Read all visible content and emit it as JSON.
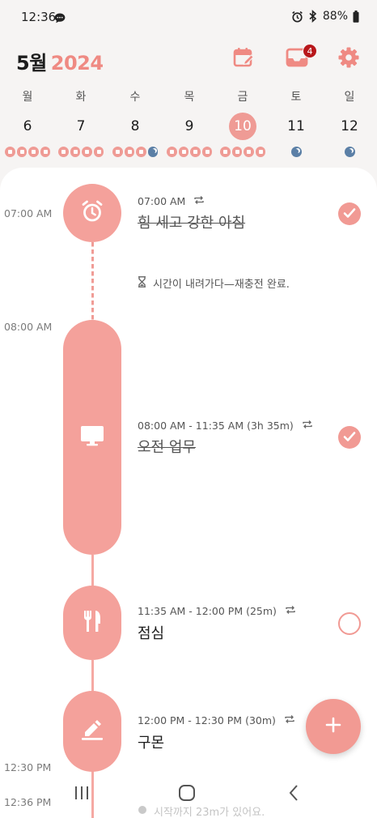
{
  "status_bar": {
    "time": "12:36",
    "battery": "88%",
    "icons": [
      "chat-icon",
      "alarm-icon",
      "bluetooth-icon",
      "battery-icon"
    ]
  },
  "header": {
    "month": "5월",
    "year": "2024",
    "icons": [
      "calendar-edit-icon",
      "inbox-icon",
      "gear-icon"
    ],
    "inbox_badge": "4",
    "accent_color": "#ef8a83"
  },
  "week": [
    {
      "name": "월",
      "num": "6",
      "dots": [
        "alarm",
        "work",
        "meal",
        "study"
      ]
    },
    {
      "name": "화",
      "num": "7",
      "dots": [
        "alarm",
        "work",
        "meal",
        "study"
      ]
    },
    {
      "name": "수",
      "num": "8",
      "dots": [
        "alarm",
        "work",
        "meal",
        "moon"
      ]
    },
    {
      "name": "목",
      "num": "9",
      "dots": [
        "alarm",
        "work",
        "meal",
        "study"
      ]
    },
    {
      "name": "금",
      "num": "10",
      "dots": [
        "alarm",
        "work",
        "meal",
        "study"
      ],
      "selected": true
    },
    {
      "name": "토",
      "num": "11",
      "dots": [
        "moon"
      ]
    },
    {
      "name": "일",
      "num": "12",
      "dots": [
        "moon"
      ]
    }
  ],
  "timeline": {
    "time_labels": [
      "07:00 AM",
      "08:00 AM",
      "12:30 PM",
      "12:36 PM"
    ],
    "events": [
      {
        "time": "07:00 AM",
        "title": "힘 세고 강한 아침",
        "done": true,
        "icon": "alarm-clock-icon",
        "repeat": true
      },
      {
        "time": "08:00 AM - 11:35 AM (3h 35m)",
        "title": "오전 업무",
        "done": true,
        "icon": "monitor-icon",
        "repeat": true
      },
      {
        "time": "11:35 AM - 12:00 PM (25m)",
        "title": "점심",
        "done": false,
        "icon": "fork-knife-icon",
        "repeat": true
      },
      {
        "time": "12:00 PM - 12:30 PM (30m)",
        "title": "구몬",
        "done": false,
        "icon": "pencil-icon",
        "repeat": true
      }
    ],
    "note": "시간이 내려가다—재충전 완료.",
    "bottom_note": "시작까지 23m가 있어요.",
    "node_color": "#f4a19b"
  },
  "fab": {
    "icon": "plus-icon"
  },
  "nav_bar": {
    "icons": [
      "recents-icon",
      "home-icon",
      "back-icon"
    ]
  }
}
